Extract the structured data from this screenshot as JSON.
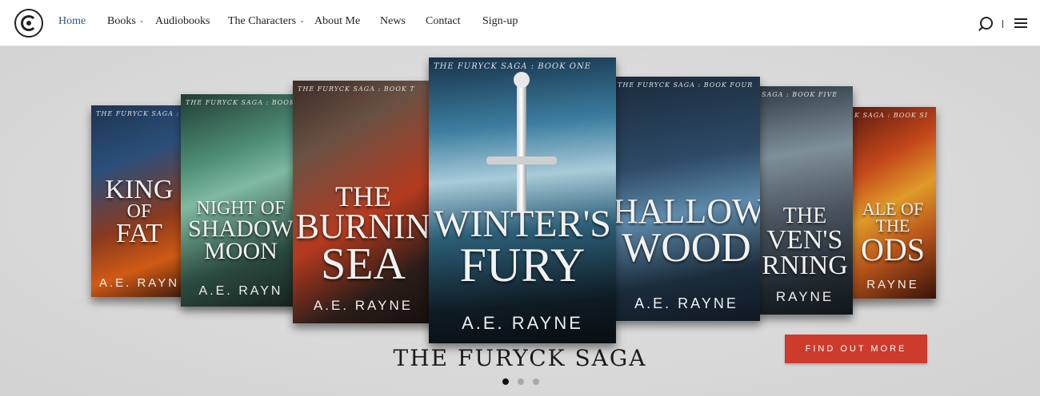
{
  "nav": {
    "items": [
      {
        "label": "Home",
        "active": true
      },
      {
        "label": "Books",
        "has_dropdown": true
      },
      {
        "label": "Audiobooks"
      },
      {
        "label": "The Characters",
        "has_dropdown": true
      },
      {
        "label": "About Me"
      },
      {
        "label": "News"
      },
      {
        "label": "Contact"
      },
      {
        "label": "Sign-up"
      }
    ],
    "icons": [
      "logo-icon",
      "search-icon",
      "menu-icon"
    ],
    "active_color": "#2a5d7a"
  },
  "hero": {
    "books": [
      {
        "series": "THE FURYCK SAGA : A PREQUEL",
        "title_lines": [
          "KING",
          "OF",
          "FAT"
        ],
        "author": "A.E. RAYN"
      },
      {
        "series": "THE FURYCK SAGA : BOOK",
        "title_lines": [
          "NIGHT OF",
          "SHADOW",
          "MOON"
        ],
        "author": "A.E. RAYN"
      },
      {
        "series": "THE FURYCK SAGA : BOOK T",
        "title_lines": [
          "THE",
          "BURNIN",
          "SEA"
        ],
        "author": "A.E. RAYNE"
      },
      {
        "series": "THE FURYCK SAGA : BOOK ONE",
        "title_lines": [
          "WINTER'S",
          "FURY"
        ],
        "author": "A.E. RAYNE"
      },
      {
        "series": "THE FURYCK SAGA : BOOK FOUR",
        "title_lines": [
          "HALLOW",
          "WOOD"
        ],
        "author": "A.E. RAYNE"
      },
      {
        "series": "SAGA : BOOK FIVE",
        "title_lines": [
          "THE",
          "VEN'S",
          "RNING"
        ],
        "author": "RAYNE"
      },
      {
        "series": "K SAGA : BOOK SI",
        "title_lines": [
          "ALE OF THE",
          "ODS"
        ],
        "author": "RAYNE"
      }
    ],
    "saga_title": "THE FURYCK SAGA",
    "cta_label": "FIND OUT MORE",
    "cta_color": "#cc3b2c",
    "carousel": {
      "slides": 3,
      "active": 1
    }
  }
}
